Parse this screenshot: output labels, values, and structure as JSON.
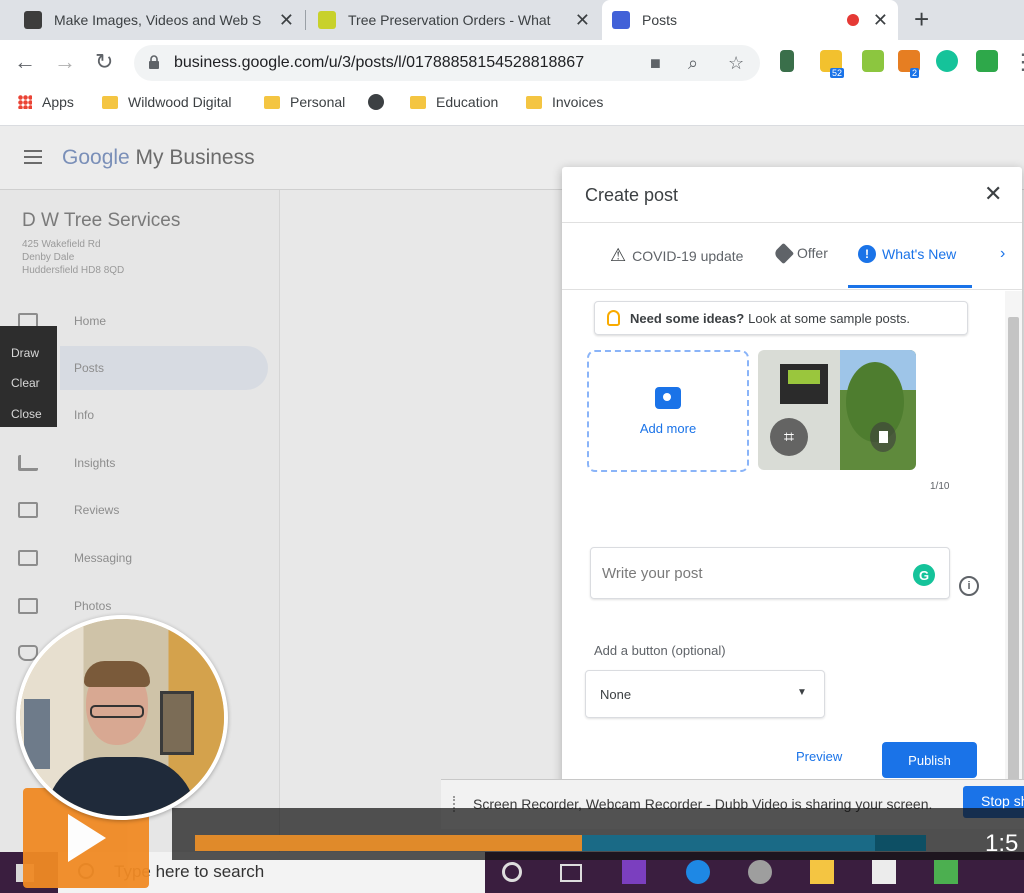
{
  "browser": {
    "tabs": [
      {
        "title": "Make Images, Videos and Web S",
        "favicon_color": "#3d3d3d",
        "active": false
      },
      {
        "title": "Tree Preservation Orders - What",
        "favicon_color": "#c8d12b",
        "active": false
      },
      {
        "title": "Posts",
        "favicon_color": "#4161d8",
        "active": true
      }
    ],
    "url": "business.google.com/u/3/posts/l/01788858154528818867",
    "bookmarks": [
      "Apps",
      "Wildwood Digital",
      "Personal",
      "Education",
      "Invoices"
    ],
    "extension_badges": [
      "52",
      "2"
    ]
  },
  "gmb": {
    "logo_google": "Google",
    "logo_rest": " My Business",
    "business_name": "D W Tree Services",
    "address_lines": [
      "425 Wakefield Rd",
      "Denby Dale",
      "Huddersfield HD8 8QD"
    ],
    "nav": [
      {
        "label": "Home",
        "icon": "home-grid-icon"
      },
      {
        "label": "Posts",
        "icon": "posts-icon",
        "active": true
      },
      {
        "label": "Info",
        "icon": "info-icon"
      },
      {
        "label": "Insights",
        "icon": "insights-icon"
      },
      {
        "label": "Reviews",
        "icon": "reviews-icon"
      },
      {
        "label": "Messaging",
        "icon": "messaging-icon"
      },
      {
        "label": "Photos",
        "icon": "photos-icon"
      }
    ]
  },
  "draw_panel": [
    "Draw",
    "Clear",
    "Close"
  ],
  "dialog": {
    "title": "Create post",
    "tabs": [
      "COVID-19 update",
      "Offer",
      "What's New"
    ],
    "active_tab": "What's New",
    "ideas_bold": "Need some ideas?",
    "ideas_rest": "Look at some sample posts.",
    "add_more_label": "Add more",
    "photo_count": "1/10",
    "post_placeholder": "Write your post",
    "button_section_label": "Add a button (optional)",
    "button_select_value": "None",
    "preview_label": "Preview",
    "publish_label": "Publish"
  },
  "share_bar": {
    "text": "Screen Recorder, Webcam Recorder - Dubb Video is sharing your screen.",
    "stop_label": "Stop sharing"
  },
  "taskbar": {
    "search_placeholder": "Type here to search"
  },
  "video_player": {
    "time": "1:5",
    "progress_fraction": 0.53,
    "buffer_fraction": 0.93
  },
  "colors": {
    "accent": "#1a73e8",
    "player_orange": "#f08a24",
    "taskbar": "#3a1e3f"
  }
}
